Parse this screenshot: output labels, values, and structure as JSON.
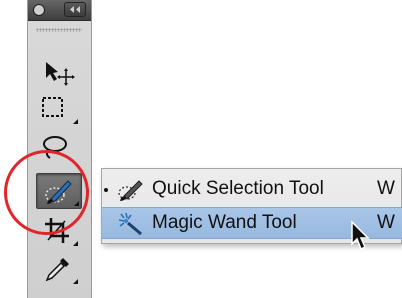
{
  "toolbox": {
    "tools": [
      {
        "name": "move-tool",
        "icon": "move-icon"
      },
      {
        "name": "rectangular-marquee-tool",
        "icon": "marquee-icon"
      },
      {
        "name": "lasso-tool",
        "icon": "lasso-icon"
      },
      {
        "name": "quick-selection-tool",
        "icon": "quick-selection-icon",
        "active": true
      },
      {
        "name": "crop-tool",
        "icon": "crop-icon"
      },
      {
        "name": "eyedropper-tool",
        "icon": "eyedropper-icon"
      }
    ]
  },
  "flyout": {
    "items": [
      {
        "label": "Quick Selection Tool",
        "shortcut": "W",
        "icon": "quick-selection-icon",
        "selected": true
      },
      {
        "label": "Magic Wand Tool",
        "shortcut": "W",
        "icon": "magic-wand-icon",
        "highlighted": true
      }
    ]
  },
  "colors": {
    "highlight_circle": "#e0262a",
    "menu_highlight": "#a9c6e8",
    "toolbox_bg": "#d4d4d4",
    "titlebar_bg": "#4a4a4a"
  }
}
